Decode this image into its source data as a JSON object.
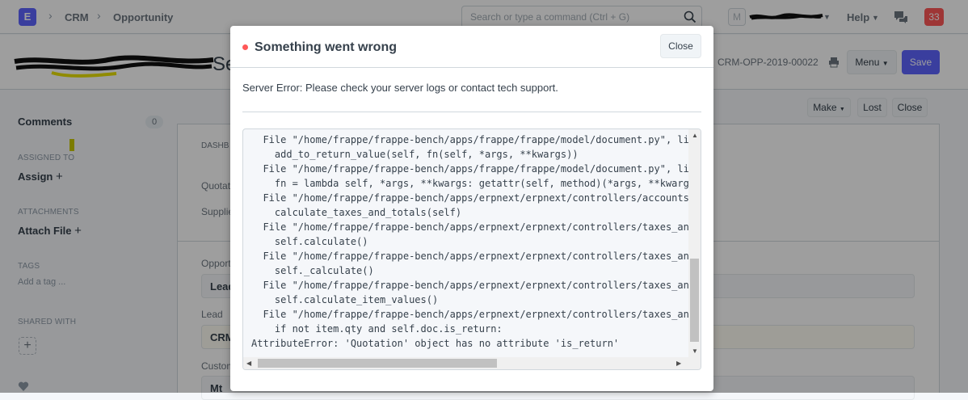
{
  "navbar": {
    "logo": "E",
    "breadcrumbs": [
      "CRM",
      "Opportunity"
    ],
    "search_placeholder": "Search or type a command (Ctrl + G)",
    "avatar_initial": "M",
    "help_label": "Help",
    "notification_count": "33"
  },
  "page_head": {
    "title_visible_fragment": "Se",
    "doc_id": "CRM-OPP-2019-00022",
    "menu_label": "Menu",
    "save_label": "Save"
  },
  "action_bar": {
    "make_label": "Make",
    "lost_label": "Lost",
    "close_label": "Close"
  },
  "sidebar": {
    "comments_label": "Comments",
    "comments_count": "0",
    "assigned_to_label": "ASSIGNED TO",
    "assign_label": "Assign",
    "attachments_label": "ATTACHMENTS",
    "attach_file_label": "Attach File",
    "tags_label": "TAGS",
    "add_tag_label": "Add a tag ...",
    "shared_with_label": "SHARED WITH"
  },
  "background_form": {
    "dashboard_label": "DASHB",
    "quotation_label": "Quotat",
    "supplier_label": "Supplie",
    "opportunity_label": "Opport",
    "opportunity_value": "Lead",
    "lead_label": "Lead",
    "lead_value": "CRM",
    "customer_label": "Custom",
    "customer_value": "Mt"
  },
  "modal": {
    "title": "Something went wrong",
    "close_label": "Close",
    "message": "Server Error: Please check your server logs or contact tech support.",
    "traceback": "  File \"/home/frappe/frappe-bench/apps/frappe/frappe/model/document.py\", lin\n    add_to_return_value(self, fn(self, *args, **kwargs))\n  File \"/home/frappe/frappe-bench/apps/frappe/frappe/model/document.py\", lin\n    fn = lambda self, *args, **kwargs: getattr(self, method)(*args, **kwargs\n  File \"/home/frappe/frappe-bench/apps/erpnext/erpnext/controllers/accounts_\n    calculate_taxes_and_totals(self)\n  File \"/home/frappe/frappe-bench/apps/erpnext/erpnext/controllers/taxes_and\n    self.calculate()\n  File \"/home/frappe/frappe-bench/apps/erpnext/erpnext/controllers/taxes_and\n    self._calculate()\n  File \"/home/frappe/frappe-bench/apps/erpnext/erpnext/controllers/taxes_and\n    self.calculate_item_values()\n  File \"/home/frappe/frappe-bench/apps/erpnext/erpnext/controllers/taxes_and\n    if not item.qty and self.doc.is_return:\nAttributeError: 'Quotation' object has no attribute 'is_return'"
  },
  "colors": {
    "primary": "#5e64ff",
    "danger": "#ff5858",
    "text": "#36414c",
    "muted": "#8d99a6"
  }
}
